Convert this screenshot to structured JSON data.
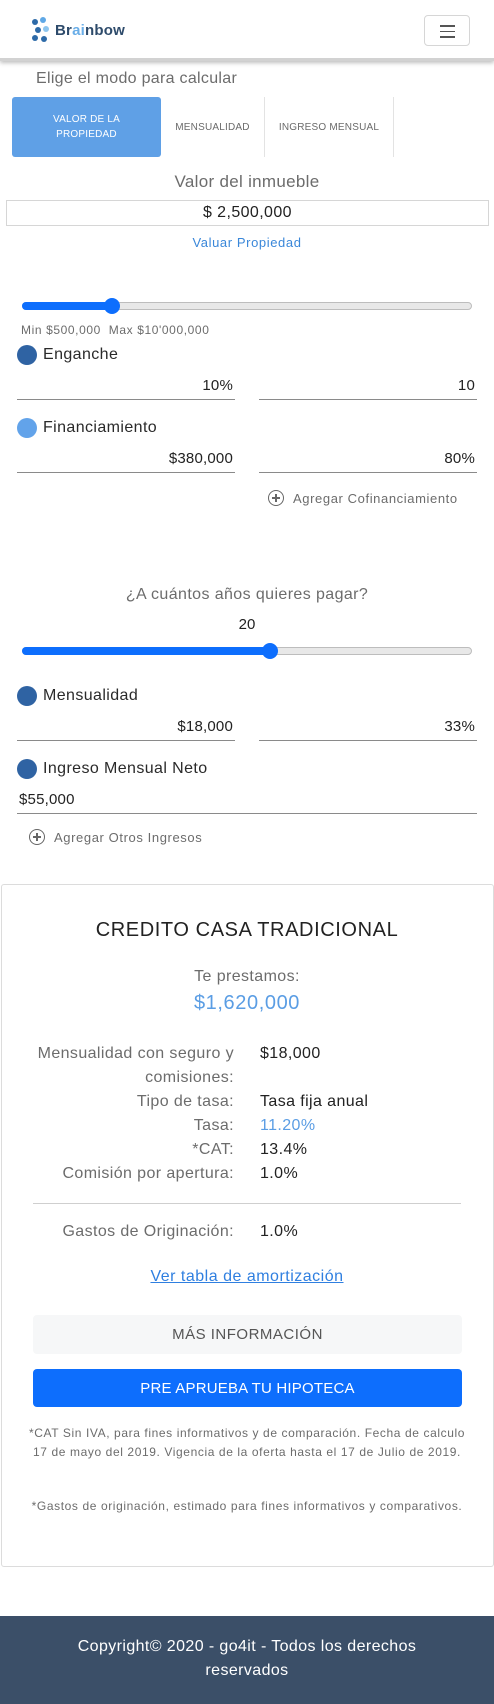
{
  "header": {
    "logo_prefix": "Br",
    "logo_highlight": "ai",
    "logo_suffix": "nbow",
    "menu_icon": "hamburger-icon"
  },
  "mode": {
    "title": "Elige el modo para calcular",
    "tabs": [
      {
        "label": "VALOR DE LA PROPIEDAD",
        "active": true
      },
      {
        "label": "MENSUALIDAD",
        "active": false
      },
      {
        "label": "INGRESO MENSUAL",
        "active": false
      }
    ]
  },
  "property": {
    "label": "Valor del inmueble",
    "value": "$ 2,500,000",
    "valuate_link": "Valuar Propiedad",
    "slider_fraction": 0.2,
    "range_text": "Min $500,000  Max $10'000,000"
  },
  "enganche": {
    "label": "Enganche",
    "percent": "10%",
    "value": "10"
  },
  "financiamiento": {
    "label": "Financiamiento",
    "amount": "$380,000",
    "percent": "80%",
    "add_link": "Agregar Cofinanciamiento"
  },
  "years": {
    "question": "¿A cuántos años quieres pagar?",
    "value": "20",
    "slider_fraction": 0.55
  },
  "mensualidad": {
    "label": "Mensualidad",
    "amount": "$18,000",
    "percent": "33%"
  },
  "ingreso": {
    "label": "Ingreso Mensual Neto",
    "amount": "$55,000",
    "add_link": "Agregar Otros Ingresos"
  },
  "result": {
    "title": "CREDITO CASA TRADICIONAL",
    "lend_label": "Te prestamos:",
    "lend_value": "$1,620,000",
    "details": [
      {
        "key": "Mensualidad con seguro y comisiones:",
        "value": "$18,000"
      },
      {
        "key": "Tipo de tasa:",
        "value": "Tasa fija anual"
      },
      {
        "key": "Tasa:",
        "value": "11.20%"
      },
      {
        "key": "*CAT:",
        "value": "13.4%"
      },
      {
        "key": "Comisión por apertura:",
        "value": "1.0%"
      }
    ],
    "gastos_key": "Gastos de Originación:",
    "gastos_value": "1.0%",
    "amort_link": "Ver tabla de amortización",
    "more_button": "MÁS INFORMACIÓN",
    "preapprove_button": "PRE APRUEBA TU HIPOTECA",
    "note_cat": "*CAT Sin IVA, para fines informativos y de comparación. Fecha de calculo 17 de mayo del 2019. Vigencia de la oferta hasta el 17 de Julio de 2019.",
    "note_gastos": "*Gastos de originación, estimado para fines informativos y comparativos."
  },
  "footer": {
    "text": "Copyright© 2020 - go4it - Todos los derechos reservados"
  },
  "colors": {
    "primary": "#0d6efd",
    "tab_active": "#5fa0e6",
    "dot_dark": "#2f63a3",
    "dot_light": "#62a3ea",
    "footer_bg": "#3b4f68"
  }
}
